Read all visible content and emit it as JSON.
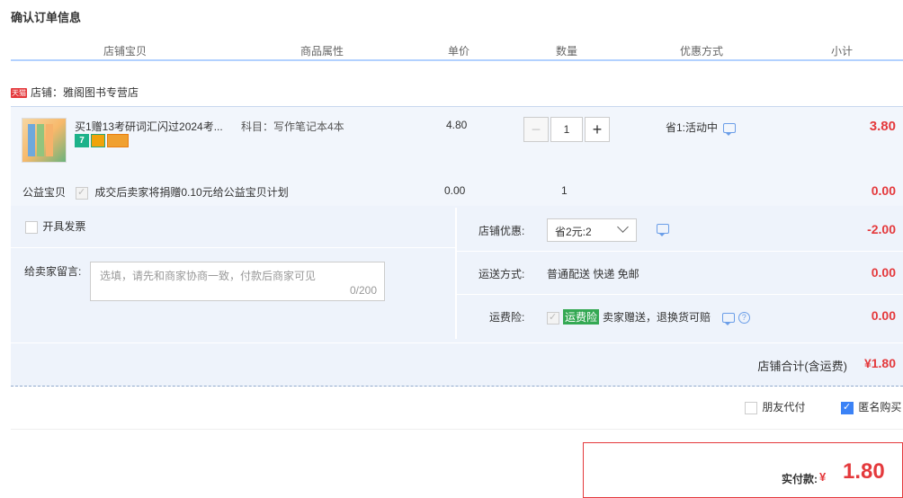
{
  "page": {
    "title": "确认订单信息"
  },
  "columns": [
    "店铺宝贝",
    "商品属性",
    "单价",
    "数量",
    "优惠方式",
    "小计"
  ],
  "shop": {
    "badge": "天猫",
    "label": "店铺：雅阁图书专营店"
  },
  "item": {
    "name": "买1赠13考研词汇闪过2024考...",
    "attr": "科目：写作笔记本4本",
    "price": "4.80",
    "quantity": "1",
    "minus_label": "−",
    "plus_label": "+",
    "promo": "省1:活动中",
    "subtotal": "3.80",
    "badges": [
      "7",
      "",
      ""
    ]
  },
  "charity": {
    "label": "公益宝贝",
    "desc": "成交后卖家将捐赠0.10元给公益宝贝计划",
    "amount": "0.00",
    "count": "1",
    "subtotal": "0.00"
  },
  "invoice": {
    "label": "开具发票"
  },
  "message": {
    "label": "给卖家留言:",
    "placeholder": "选填，请先和商家协商一致，付款后商家可见",
    "counter": "0/200"
  },
  "shop_discount": {
    "label": "店铺优惠:",
    "selected": "省2元:2",
    "amount": "-2.00"
  },
  "shipping": {
    "label": "运送方式:",
    "value": "普通配送 快递 免邮",
    "amount": "0.00"
  },
  "insurance": {
    "label": "运费险:",
    "tag": "运费险",
    "value": "卖家赠送，退换货可赔",
    "amount": "0.00",
    "help": "?"
  },
  "shop_total": {
    "label": "店铺合计(含运费)",
    "value": "¥1.80"
  },
  "options": {
    "friend_pay": "朋友代付",
    "anonymous": "匿名购买"
  },
  "payment": {
    "label": "实付款:",
    "currency": "¥",
    "value": "1.80"
  },
  "colors": {
    "accent": "#e4393c",
    "panel": "#eef3fb",
    "header_line": "#b2d1ff",
    "check": "#3b82f6"
  }
}
